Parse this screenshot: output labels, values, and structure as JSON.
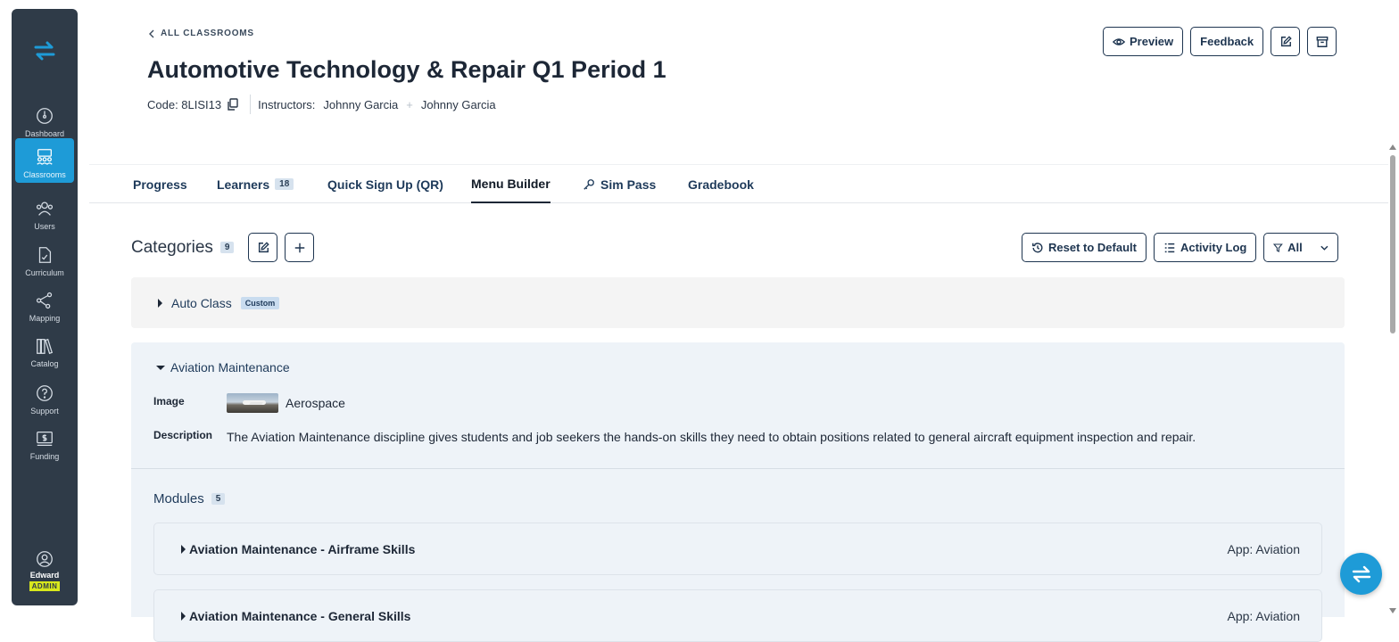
{
  "sidebar": {
    "items": [
      {
        "label": "Dashboard",
        "icon": "dashboard-icon"
      },
      {
        "label": "Classrooms",
        "icon": "classrooms-icon",
        "active": true
      },
      {
        "label": "Users",
        "icon": "users-icon"
      },
      {
        "label": "Curriculum",
        "icon": "curriculum-icon"
      },
      {
        "label": "Mapping",
        "icon": "mapping-icon"
      },
      {
        "label": "Catalog",
        "icon": "catalog-icon"
      },
      {
        "label": "Support",
        "icon": "support-icon"
      },
      {
        "label": "Funding",
        "icon": "funding-icon"
      }
    ],
    "user": {
      "name": "Edward",
      "role": "ADMIN"
    }
  },
  "header": {
    "breadcrumb": "ALL CLASSROOMS",
    "title": "Automotive Technology & Repair Q1 Period 1",
    "code_label": "Code: 8LISI13",
    "instructors_label": "Instructors:",
    "instructor_1": "Johnny Garcia",
    "instructor_2": "Johnny Garcia",
    "preview_label": "Preview",
    "feedback_label": "Feedback"
  },
  "tabs": [
    {
      "label": "Progress"
    },
    {
      "label": "Learners",
      "count": "18"
    },
    {
      "label": "Quick Sign Up (QR)"
    },
    {
      "label": "Menu Builder",
      "active": true
    },
    {
      "label": "Sim Pass"
    },
    {
      "label": "Gradebook"
    }
  ],
  "categories": {
    "title": "Categories",
    "count": "9",
    "reset_label": "Reset to Default",
    "activity_label": "Activity Log",
    "filter_label": "All"
  },
  "category_collapsed": {
    "name": "Auto Class",
    "badge": "Custom"
  },
  "category_expanded": {
    "name": "Aviation Maintenance",
    "image_label": "Image",
    "image_name": "Aerospace",
    "description_label": "Description",
    "description": "The Aviation Maintenance discipline gives students and job seekers the hands-on skills they need to obtain positions related to general aircraft equipment inspection and repair.",
    "modules_label": "Modules",
    "modules_count": "5",
    "modules": [
      {
        "name": "Aviation Maintenance - Airframe Skills",
        "app": "App: Aviation"
      },
      {
        "name": "Aviation Maintenance - General Skills",
        "app": "App: Aviation"
      }
    ]
  },
  "colors": {
    "sidebar_bg": "#2f3b48",
    "accent": "#1e9bd7",
    "admin_badge": "#d8e81c"
  }
}
